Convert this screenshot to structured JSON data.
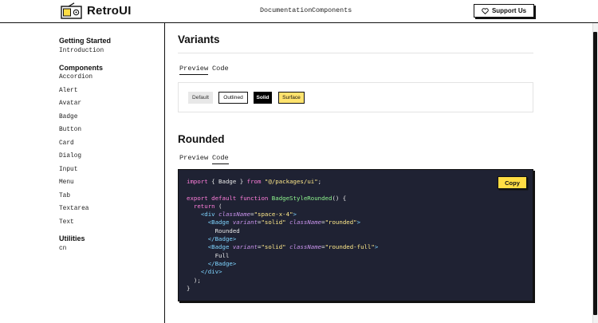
{
  "header": {
    "brand": "RetroUI",
    "nav": [
      "Documentation",
      "Components"
    ],
    "support_label": "Support Us",
    "support_icon": "heart-icon",
    "logo_icon": "radio-icon"
  },
  "sidebar": {
    "sections": [
      {
        "heading": "Getting Started",
        "items": [
          "Introduction"
        ]
      },
      {
        "heading": "Components",
        "items": [
          "Accordion",
          "Alert",
          "Avatar",
          "Badge",
          "Button",
          "Card",
          "Dialog",
          "Input",
          "Menu",
          "Tab",
          "Textarea",
          "Text"
        ]
      },
      {
        "heading": "Utilities",
        "items": [
          "cn"
        ]
      }
    ]
  },
  "variants": {
    "title": "Variants",
    "tabs": [
      "Preview",
      "Code"
    ],
    "active_tab": "Preview",
    "badges": [
      "Default",
      "Outlined",
      "Solid",
      "Surface"
    ]
  },
  "rounded": {
    "title": "Rounded",
    "tabs": [
      "Preview",
      "Code"
    ],
    "active_tab": "Code",
    "copy_label": "Copy",
    "code": {
      "import_kw": "import",
      "import_names": "{ Badge }",
      "from_kw": "from",
      "import_path": "\"@/packages/ui\"",
      "export_kw": "export default function",
      "fn_name": "BadgeStyleRounded",
      "return_kw": "return",
      "div_tag": "div",
      "badge_tag": "Badge",
      "class_attr": "className",
      "variant_attr": "variant",
      "div_class": "\"space-x-4\"",
      "variant_val": "\"solid\"",
      "class_rounded": "\"rounded\"",
      "class_full": "\"rounded-full\"",
      "text_rounded": "Rounded",
      "text_full": "Full"
    }
  },
  "colors": {
    "accent_yellow": "#ffdd44",
    "surface_yellow": "#ffe36e",
    "code_bg": "#1f2233"
  }
}
